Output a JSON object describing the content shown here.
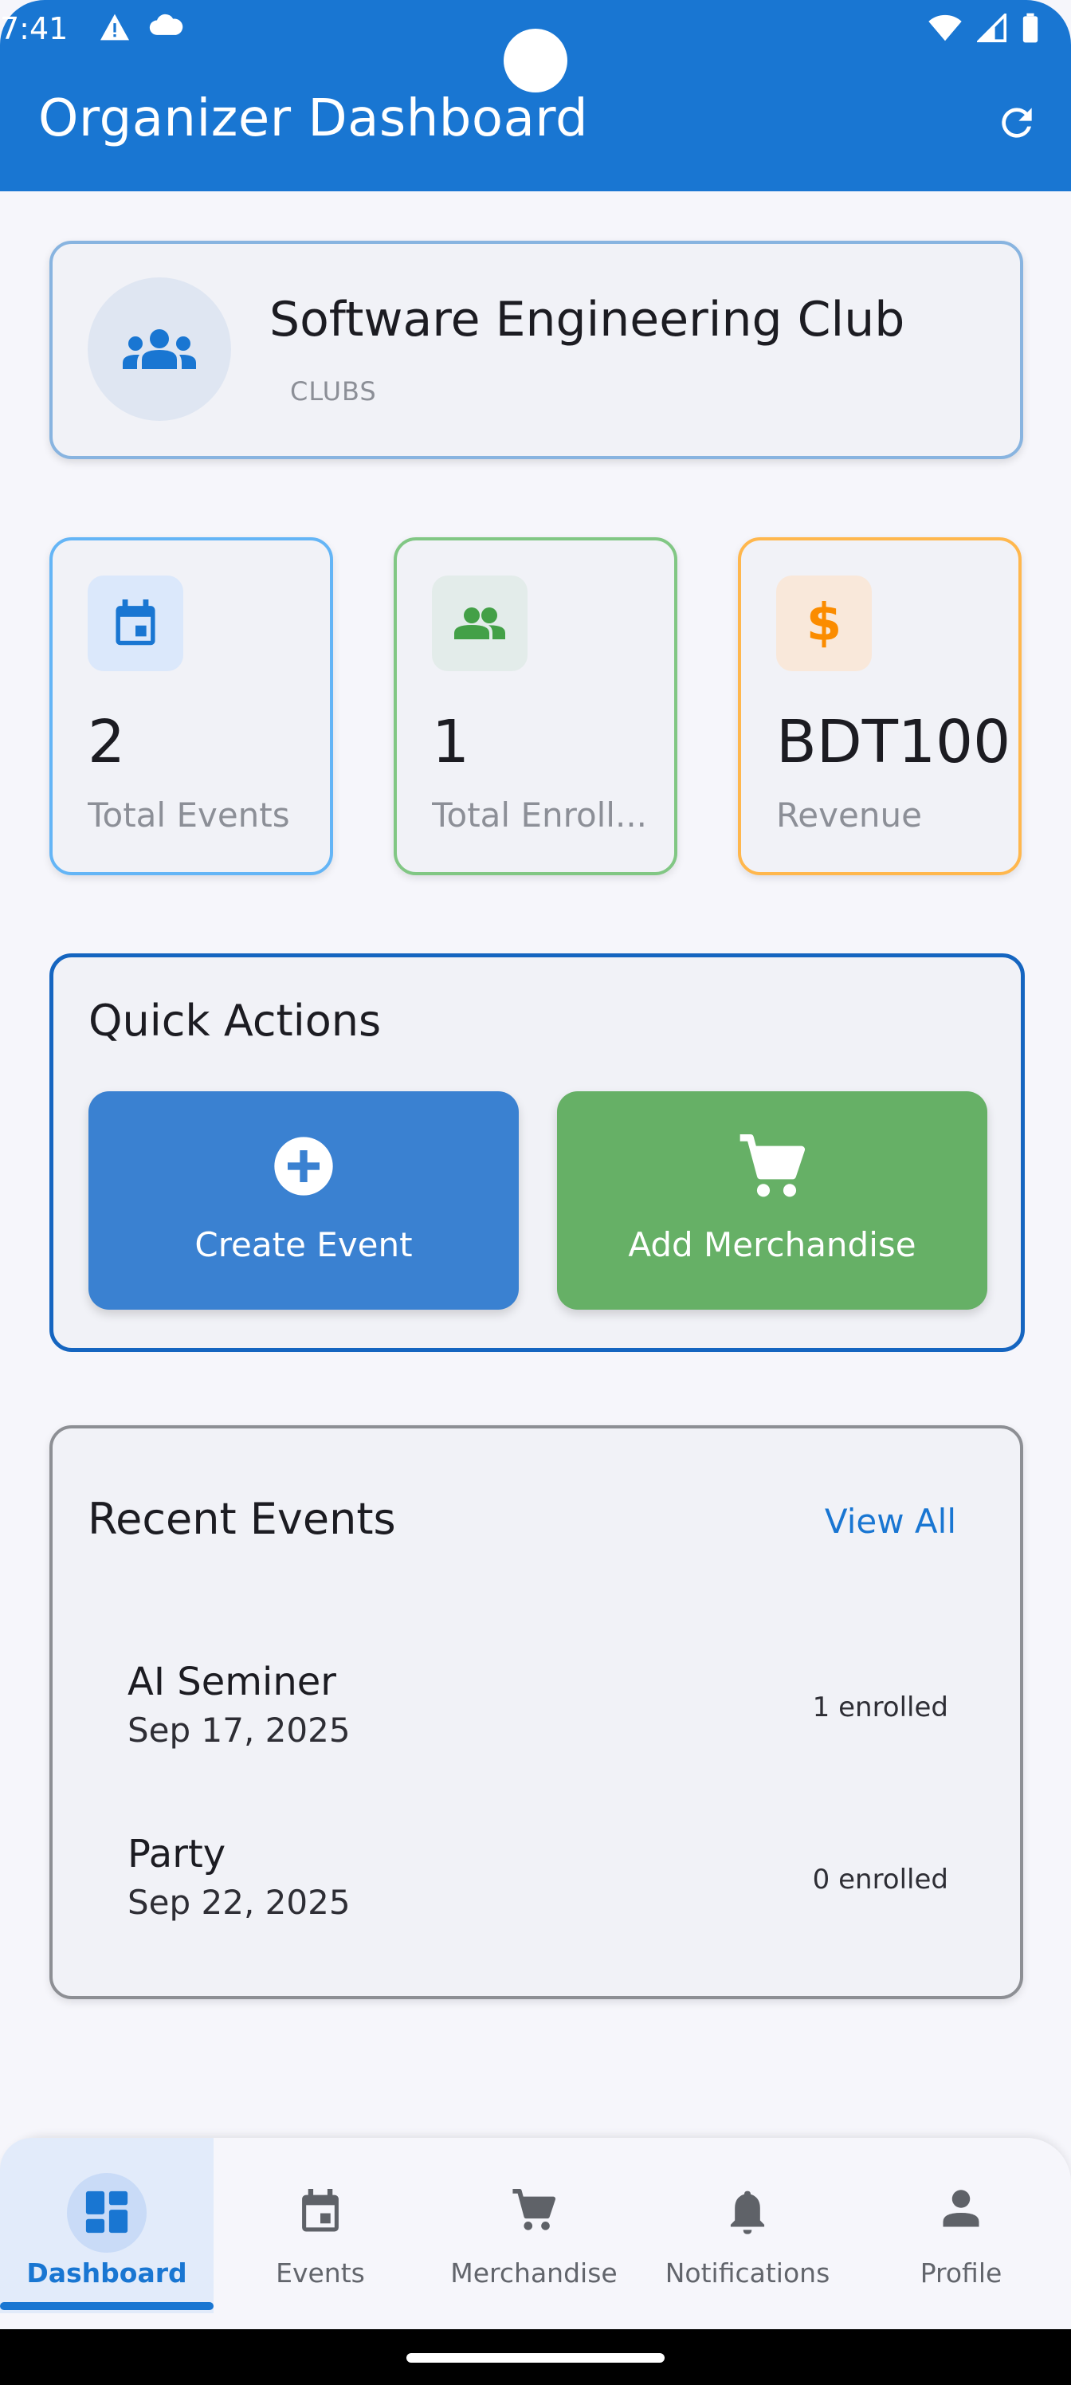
{
  "status_bar": {
    "time": "7:41"
  },
  "app_bar": {
    "title": "Organizer Dashboard",
    "refresh_icon": "refresh-icon"
  },
  "club": {
    "name": "Software Engineering Club",
    "category": "CLUBS",
    "icon": "groups-icon"
  },
  "stats": [
    {
      "value": "2",
      "label": "Total Events",
      "icon": "calendar-icon",
      "border": "#64b5f6",
      "icon_bg": "#dbe8fb",
      "icon_color": "#1976d2"
    },
    {
      "value": "1",
      "label": "Total Enroll...",
      "icon": "people-icon",
      "border": "#81c784",
      "icon_bg": "#e3ecea",
      "icon_color": "#43a047"
    },
    {
      "value": "BDT100",
      "label": "Revenue",
      "icon": "dollar-icon",
      "border": "#ffb74d",
      "icon_bg": "#f9e8da",
      "icon_color": "#fb8c00"
    }
  ],
  "quick_actions": {
    "title": "Quick Actions",
    "buttons": [
      {
        "label": "Create Event",
        "icon": "add-circle-icon",
        "color": "#3a81d1"
      },
      {
        "label": "Add Merchandise",
        "icon": "cart-icon",
        "color": "#66b066"
      }
    ]
  },
  "recent_events": {
    "title": "Recent Events",
    "view_all": "View All",
    "items": [
      {
        "name": "AI Seminer",
        "date": "Sep 17, 2025",
        "enrolled": "1 enrolled"
      },
      {
        "name": "Party",
        "date": "Sep 22, 2025",
        "enrolled": "0 enrolled"
      }
    ]
  },
  "bottom_nav": [
    {
      "label": "Dashboard",
      "icon": "dashboard-icon",
      "active": true
    },
    {
      "label": "Events",
      "icon": "calendar-icon",
      "active": false
    },
    {
      "label": "Merchandise",
      "icon": "cart-icon",
      "active": false
    },
    {
      "label": "Notifications",
      "icon": "bell-icon",
      "active": false
    },
    {
      "label": "Profile",
      "icon": "person-icon",
      "active": false
    }
  ],
  "colors": {
    "primary": "#1976d2",
    "background": "#f6f6fb"
  }
}
